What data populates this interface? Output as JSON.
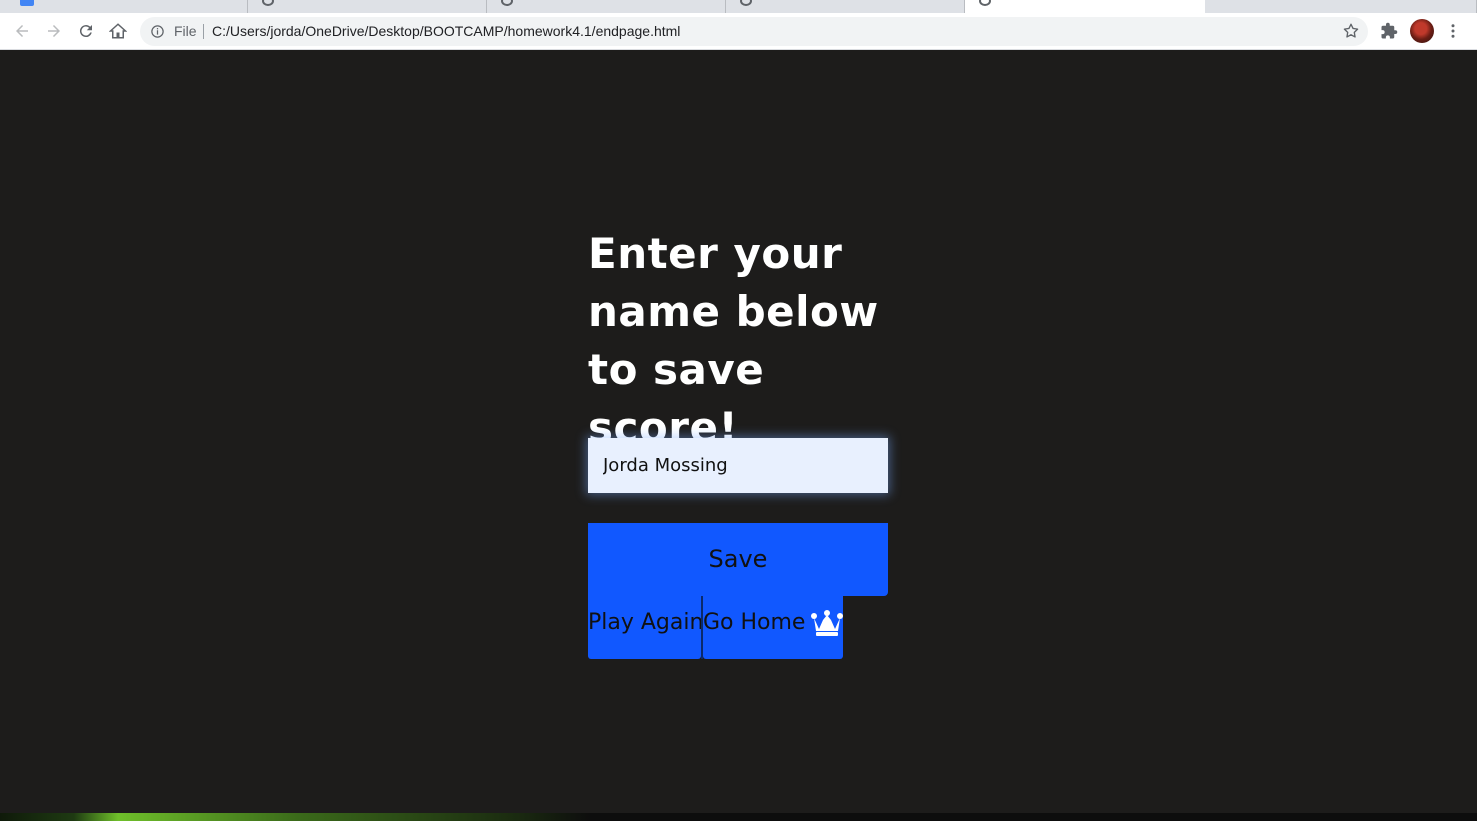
{
  "browser": {
    "tabs": [
      {
        "kind": "docs"
      },
      {
        "kind": "web"
      },
      {
        "kind": "web"
      },
      {
        "kind": "web"
      },
      {
        "kind": "web",
        "active": true
      },
      {
        "kind": "web"
      }
    ],
    "address_bar": {
      "scheme_label": "File",
      "url": "C:/Users/jorda/OneDrive/Desktop/BOOTCAMP/homework4.1/endpage.html"
    },
    "icons": [
      "back-icon",
      "forward-icon",
      "reload-icon",
      "home-icon",
      "info-icon",
      "bookmark-star-icon",
      "extensions-icon",
      "avatar",
      "menu-icon"
    ]
  },
  "page": {
    "heading": "Enter your name below to save score!",
    "name_input": {
      "value": "Jorda Mossing",
      "placeholder": ""
    },
    "save_button": "Save",
    "play_again_button": "Play Again",
    "go_home_button": "Go Home",
    "crown_icon": "crown-icon"
  },
  "colors": {
    "page_background": "#1d1c1b",
    "button_blue": "#1158ff",
    "input_background": "#e8f0fe",
    "heading_text": "#ffffff"
  }
}
